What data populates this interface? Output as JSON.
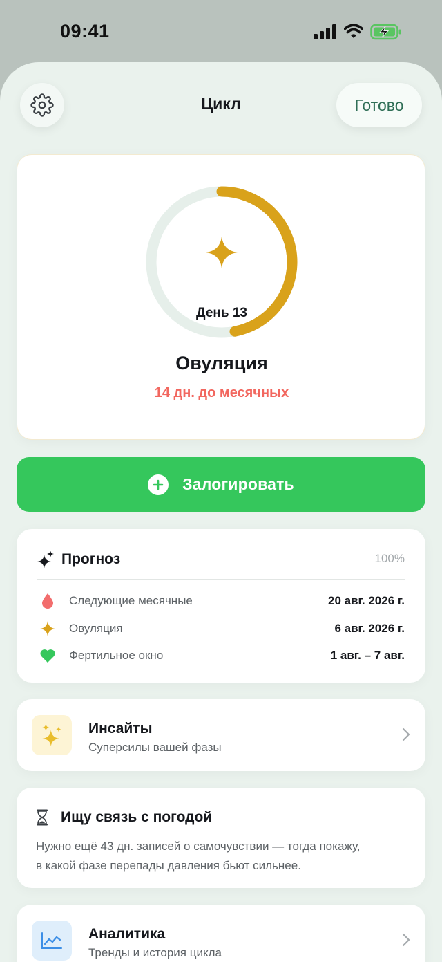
{
  "status_bar": {
    "time": "09:41"
  },
  "header": {
    "title": "Цикл",
    "done_label": "Готово"
  },
  "cycle": {
    "day_label": "День 13",
    "phase": "Овуляция",
    "countdown": "14 дн. до месячных",
    "progress": 0.47
  },
  "log_button": {
    "label": "Залогировать"
  },
  "forecast": {
    "title": "Прогноз",
    "accuracy": "100%",
    "rows": [
      {
        "icon": "drop-icon",
        "label": "Следующие месячные",
        "value": "20 авг. 2026 г."
      },
      {
        "icon": "sparkle-icon",
        "label": "Овуляция",
        "value": "6 авг. 2026 г."
      },
      {
        "icon": "heart-icon",
        "label": "Фертильное окно",
        "value": "1 авг. – 7 авг."
      }
    ]
  },
  "insights": {
    "title": "Инсайты",
    "subtitle": "Суперсилы вашей фазы"
  },
  "weather": {
    "title": "Ищу связь с погодой",
    "body_line1": "Нужно ещё 43 дн. записей о самочувствии — тогда покажу,",
    "body_line2": "в какой фазе перепады давления бьют сильнее."
  },
  "analytics": {
    "title": "Аналитика",
    "subtitle": "Тренды и история цикла"
  },
  "colors": {
    "accent_green": "#35c75c",
    "ring_gold": "#d9a21b",
    "ring_track": "#e6efea",
    "countdown_red": "#f2675f",
    "background": "#eaf2ed"
  }
}
